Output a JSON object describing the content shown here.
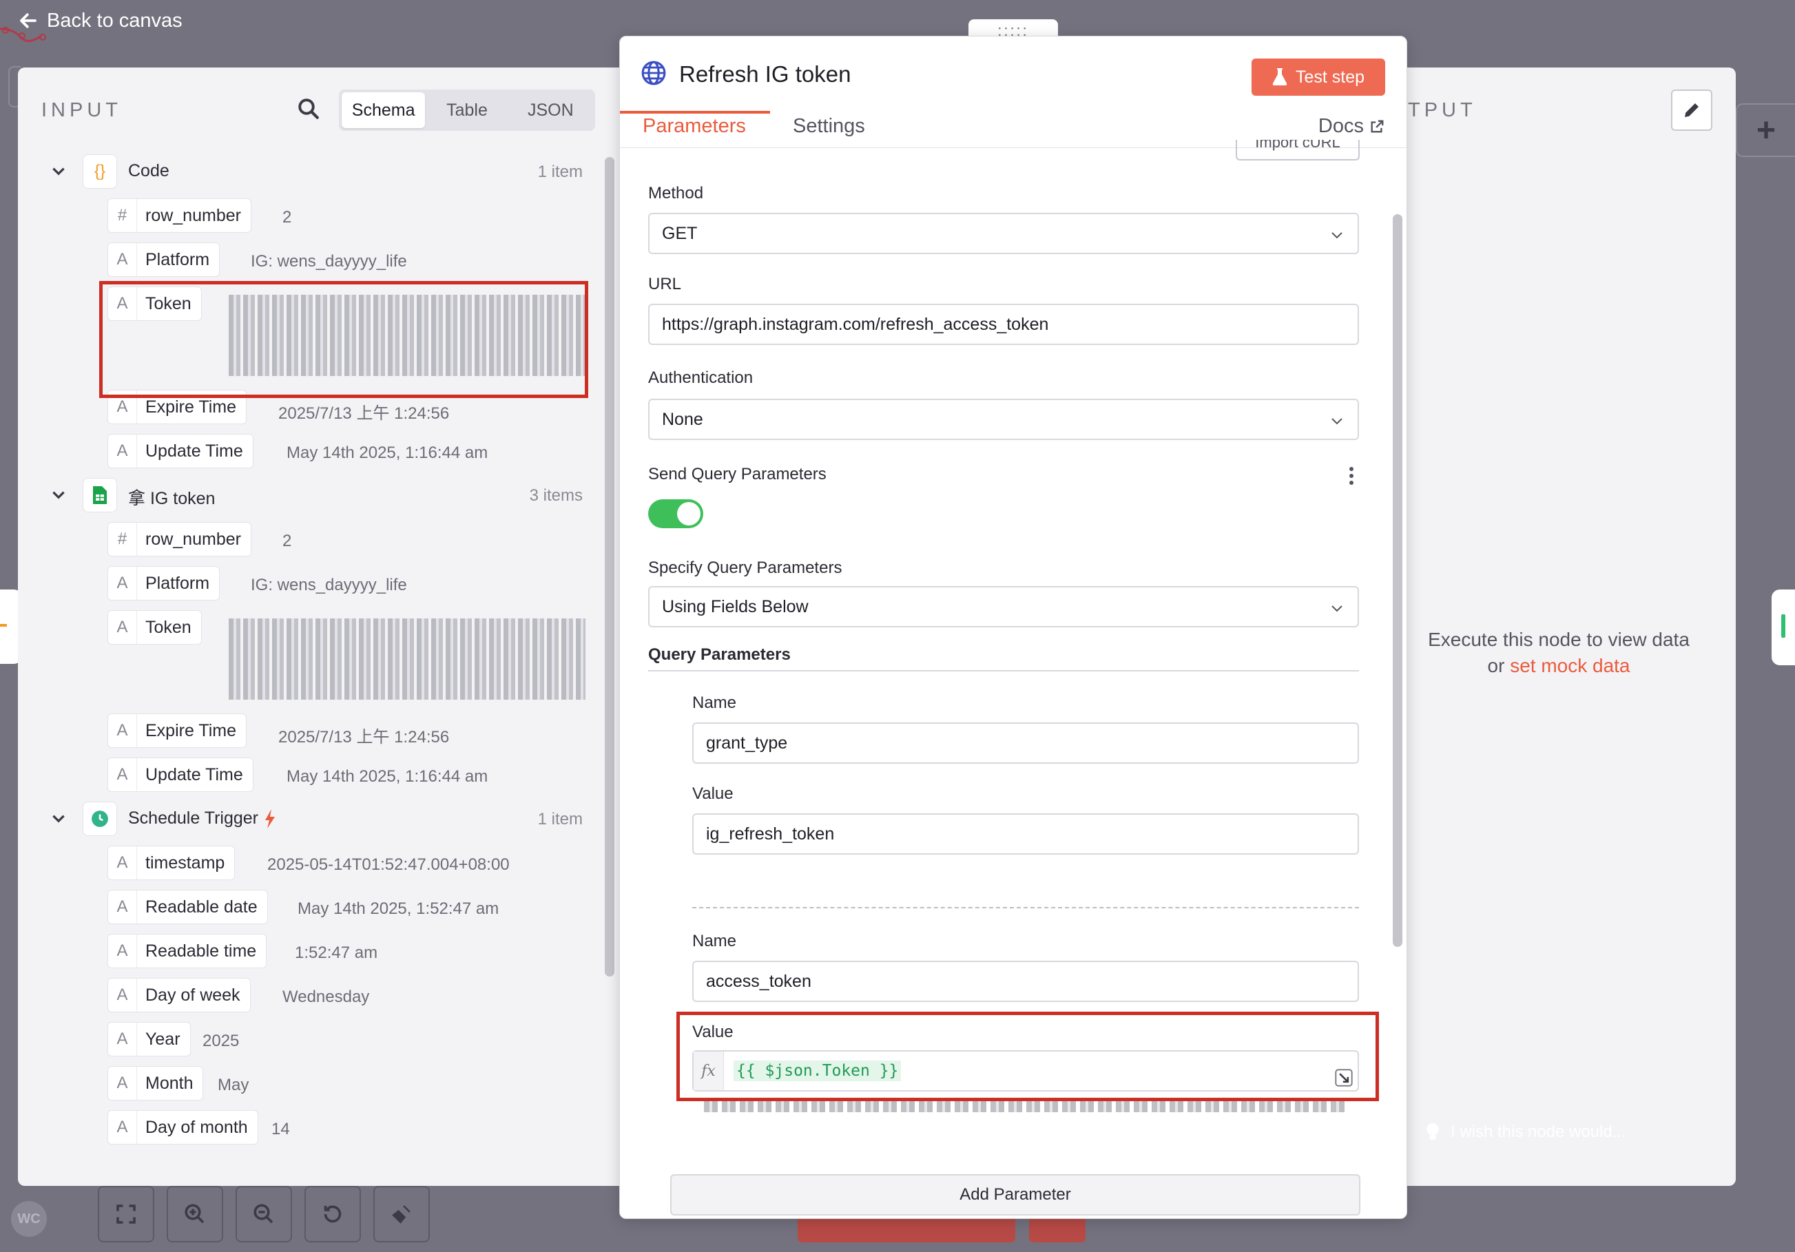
{
  "canvas": {
    "back_label": "Back to canvas",
    "avatar_initials": "WC",
    "wish_label": "I wish this node would..."
  },
  "input_pane": {
    "title": "INPUT",
    "views": [
      "Schema",
      "Table",
      "JSON"
    ],
    "active_view": "Schema",
    "groups": [
      {
        "name": "Code",
        "icon": "code-braces-icon",
        "count": "1 item",
        "fields": [
          {
            "type": "#",
            "name": "row_number",
            "value": "2"
          },
          {
            "type": "A",
            "name": "Platform",
            "value": "IG: wens_dayyyy_life"
          },
          {
            "type": "A",
            "name": "Token",
            "value": ""
          },
          {
            "type": "A",
            "name": "Expire Time",
            "value": "2025/7/13 上午 1:24:56"
          },
          {
            "type": "A",
            "name": "Update Time",
            "value": "May 14th 2025, 1:16:44 am"
          }
        ]
      },
      {
        "name": "拿 IG token",
        "icon": "spreadsheet-icon",
        "count": "3 items",
        "fields": [
          {
            "type": "#",
            "name": "row_number",
            "value": "2"
          },
          {
            "type": "A",
            "name": "Platform",
            "value": "IG: wens_dayyyy_life"
          },
          {
            "type": "A",
            "name": "Token",
            "value": ""
          },
          {
            "type": "A",
            "name": "Expire Time",
            "value": "2025/7/13 上午 1:24:56"
          },
          {
            "type": "A",
            "name": "Update Time",
            "value": "May 14th 2025, 1:16:44 am"
          }
        ]
      },
      {
        "name": "Schedule Trigger",
        "icon": "clock-icon",
        "count": "1 item",
        "fields": [
          {
            "type": "A",
            "name": "timestamp",
            "value": "2025-05-14T01:52:47.004+08:00"
          },
          {
            "type": "A",
            "name": "Readable date",
            "value": "May 14th 2025, 1:52:47 am"
          },
          {
            "type": "A",
            "name": "Readable time",
            "value": "1:52:47 am"
          },
          {
            "type": "A",
            "name": "Day of week",
            "value": "Wednesday"
          },
          {
            "type": "A",
            "name": "Year",
            "value": "2025"
          },
          {
            "type": "A",
            "name": "Month",
            "value": "May"
          },
          {
            "type": "A",
            "name": "Day of month",
            "value": "14"
          }
        ]
      }
    ]
  },
  "output_pane": {
    "title": "TPUT",
    "message": "Execute this node to view data",
    "message_or": "or",
    "mock_link": "set mock data"
  },
  "node": {
    "title": "Refresh IG token",
    "test_button": "Test step",
    "tabs": [
      "Parameters",
      "Settings"
    ],
    "active_tab": "Parameters",
    "docs_label": "Docs",
    "import_curl": "Import cURL",
    "method_label": "Method",
    "method_value": "GET",
    "url_label": "URL",
    "url_value": "https://graph.instagram.com/refresh_access_token",
    "auth_label": "Authentication",
    "auth_value": "None",
    "send_query_label": "Send Query Parameters",
    "send_query_enabled": true,
    "specify_label": "Specify Query Parameters",
    "specify_value": "Using Fields Below",
    "query_section": "Query Parameters",
    "params": [
      {
        "name_label": "Name",
        "name": "grant_type",
        "value_label": "Value",
        "value": "ig_refresh_token"
      },
      {
        "name_label": "Name",
        "name": "access_token",
        "value_label": "Value",
        "value": "{{ $json.Token }}"
      }
    ],
    "fx_label": "fx",
    "add_param": "Add Parameter"
  },
  "colors": {
    "accent": "#ea5b3c",
    "test_button": "#ee6a52",
    "toggle_on": "#3fbf5a",
    "highlight_box": "#cc2e24",
    "expression": "#1f9b55"
  }
}
